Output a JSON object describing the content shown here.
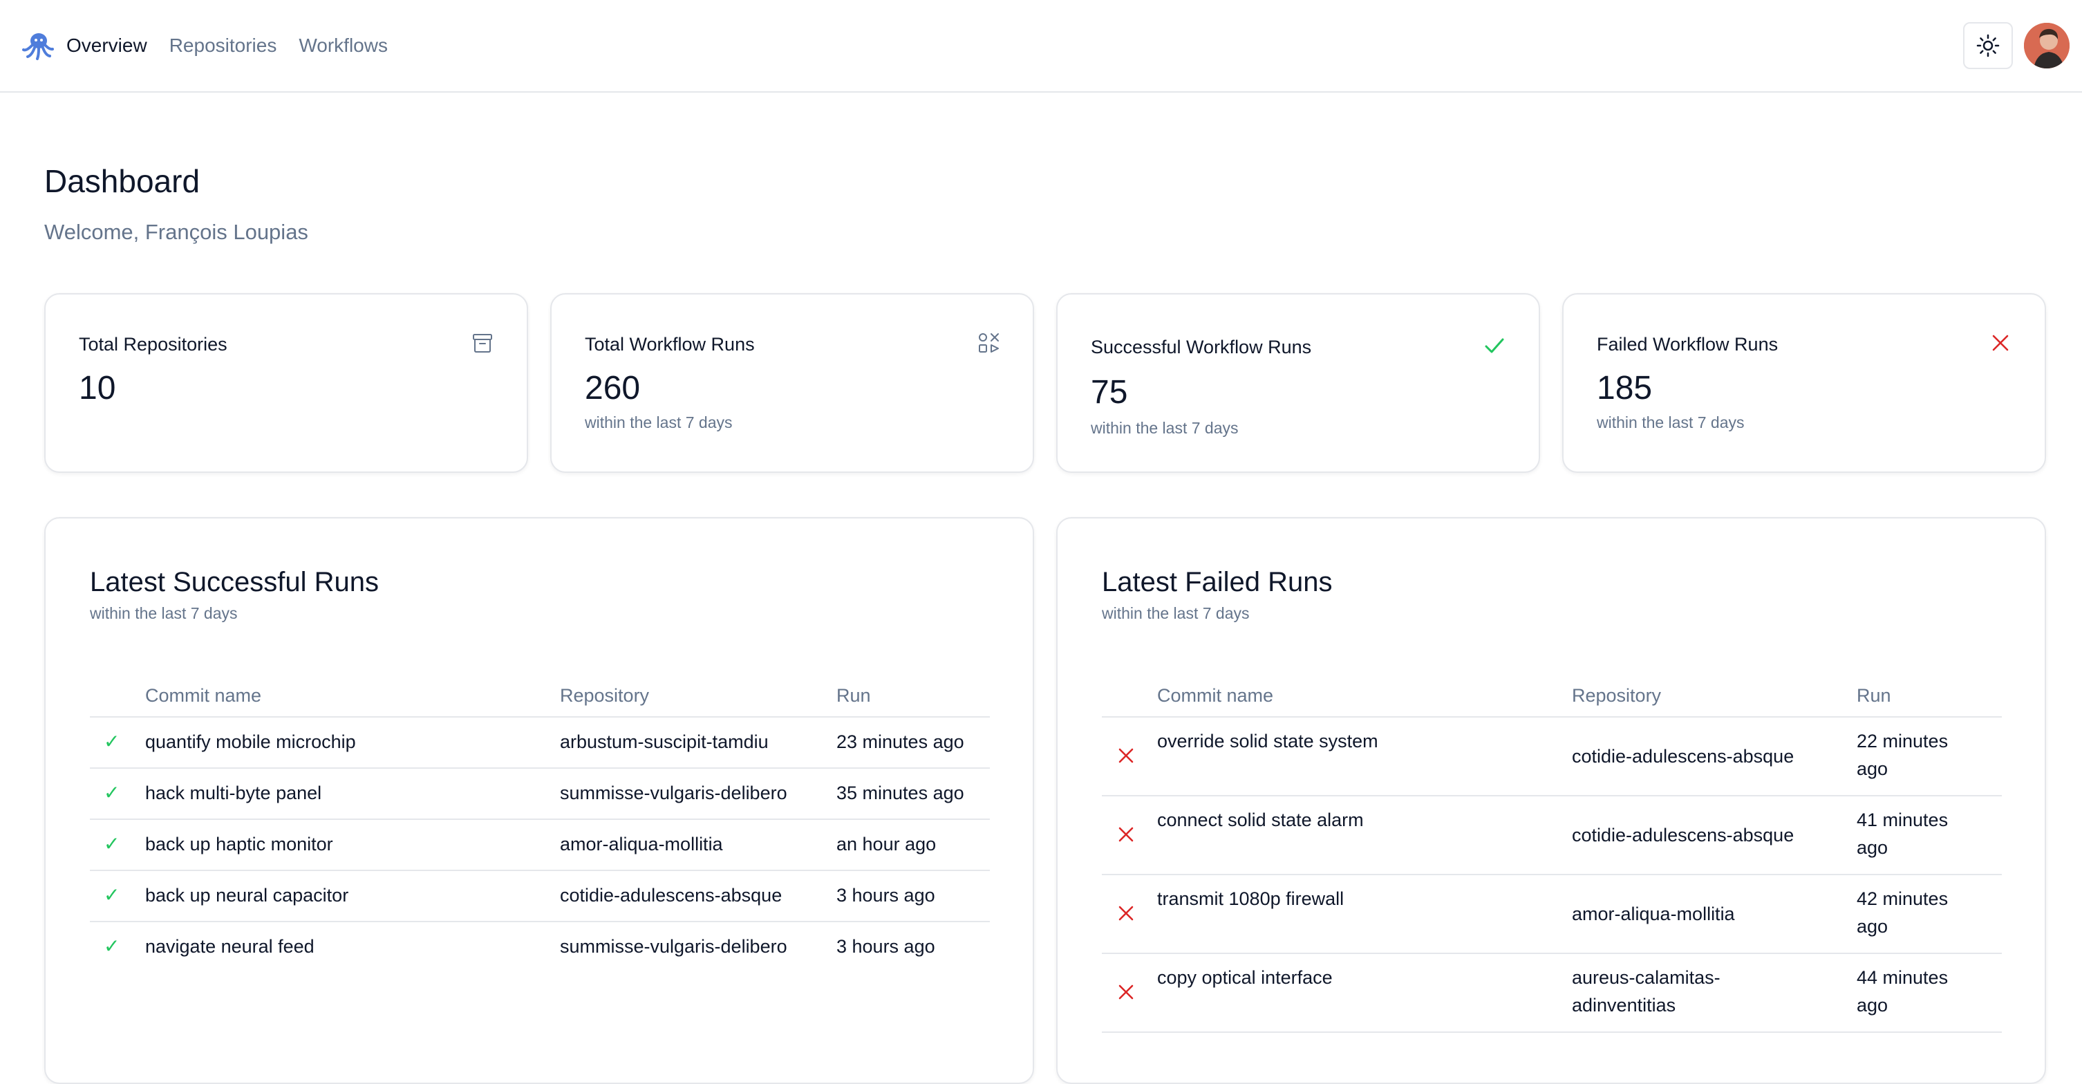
{
  "nav": {
    "items": [
      {
        "label": "Overview",
        "active": true
      },
      {
        "label": "Repositories",
        "active": false
      },
      {
        "label": "Workflows",
        "active": false
      }
    ]
  },
  "header": {
    "theme_icon": "sun-icon",
    "logo_icon": "octopus-logo-icon"
  },
  "page": {
    "title": "Dashboard",
    "welcome": "Welcome, François Loupias"
  },
  "stats": [
    {
      "label": "Total Repositories",
      "value": "10",
      "sub": "",
      "icon": "archive-icon"
    },
    {
      "label": "Total Workflow Runs",
      "value": "260",
      "sub": "within the last 7 days",
      "icon": "workflow-icon"
    },
    {
      "label": "Successful Workflow Runs",
      "value": "75",
      "sub": "within the last 7 days",
      "icon": "check-icon"
    },
    {
      "label": "Failed Workflow Runs",
      "value": "185",
      "sub": "within the last 7 days",
      "icon": "x-icon"
    }
  ],
  "successful_runs": {
    "title": "Latest Successful Runs",
    "subtitle": "within the last 7 days",
    "columns": [
      "Commit name",
      "Repository",
      "Run"
    ],
    "rows": [
      {
        "commit": "quantify mobile microchip",
        "repo": "arbustum-suscipit-tamdiu",
        "run": "23 minutes ago"
      },
      {
        "commit": "hack multi-byte panel",
        "repo": "summisse-vulgaris-delibero",
        "run": "35 minutes ago"
      },
      {
        "commit": "back up haptic monitor",
        "repo": "amor-aliqua-mollitia",
        "run": "an hour ago"
      },
      {
        "commit": "back up neural capacitor",
        "repo": "cotidie-adulescens-absque",
        "run": "3 hours ago"
      },
      {
        "commit": "navigate neural feed",
        "repo": "summisse-vulgaris-delibero",
        "run": "3 hours ago"
      }
    ]
  },
  "failed_runs": {
    "title": "Latest Failed Runs",
    "subtitle": "within the last 7 days",
    "columns": [
      "Commit name",
      "Repository",
      "Run"
    ],
    "rows": [
      {
        "commit": "override solid state system",
        "repo": "cotidie-adulescens-absque",
        "run_1": "22 minutes",
        "run_2": "ago"
      },
      {
        "commit": "connect solid state alarm",
        "repo": "cotidie-adulescens-absque",
        "run_1": "41 minutes",
        "run_2": "ago"
      },
      {
        "commit": "transmit 1080p firewall",
        "repo": "amor-aliqua-mollitia",
        "run_1": "42 minutes",
        "run_2": "ago"
      },
      {
        "commit": "copy optical interface",
        "repo_1": "aureus-calamitas-",
        "repo_2": "adinventitias",
        "run_1": "44 minutes",
        "run_2": "ago"
      }
    ]
  },
  "colors": {
    "success": "#22c55e",
    "failure": "#dc2626",
    "muted": "#64748b",
    "border": "#e5e7eb",
    "accent": "#4f7ddb"
  }
}
